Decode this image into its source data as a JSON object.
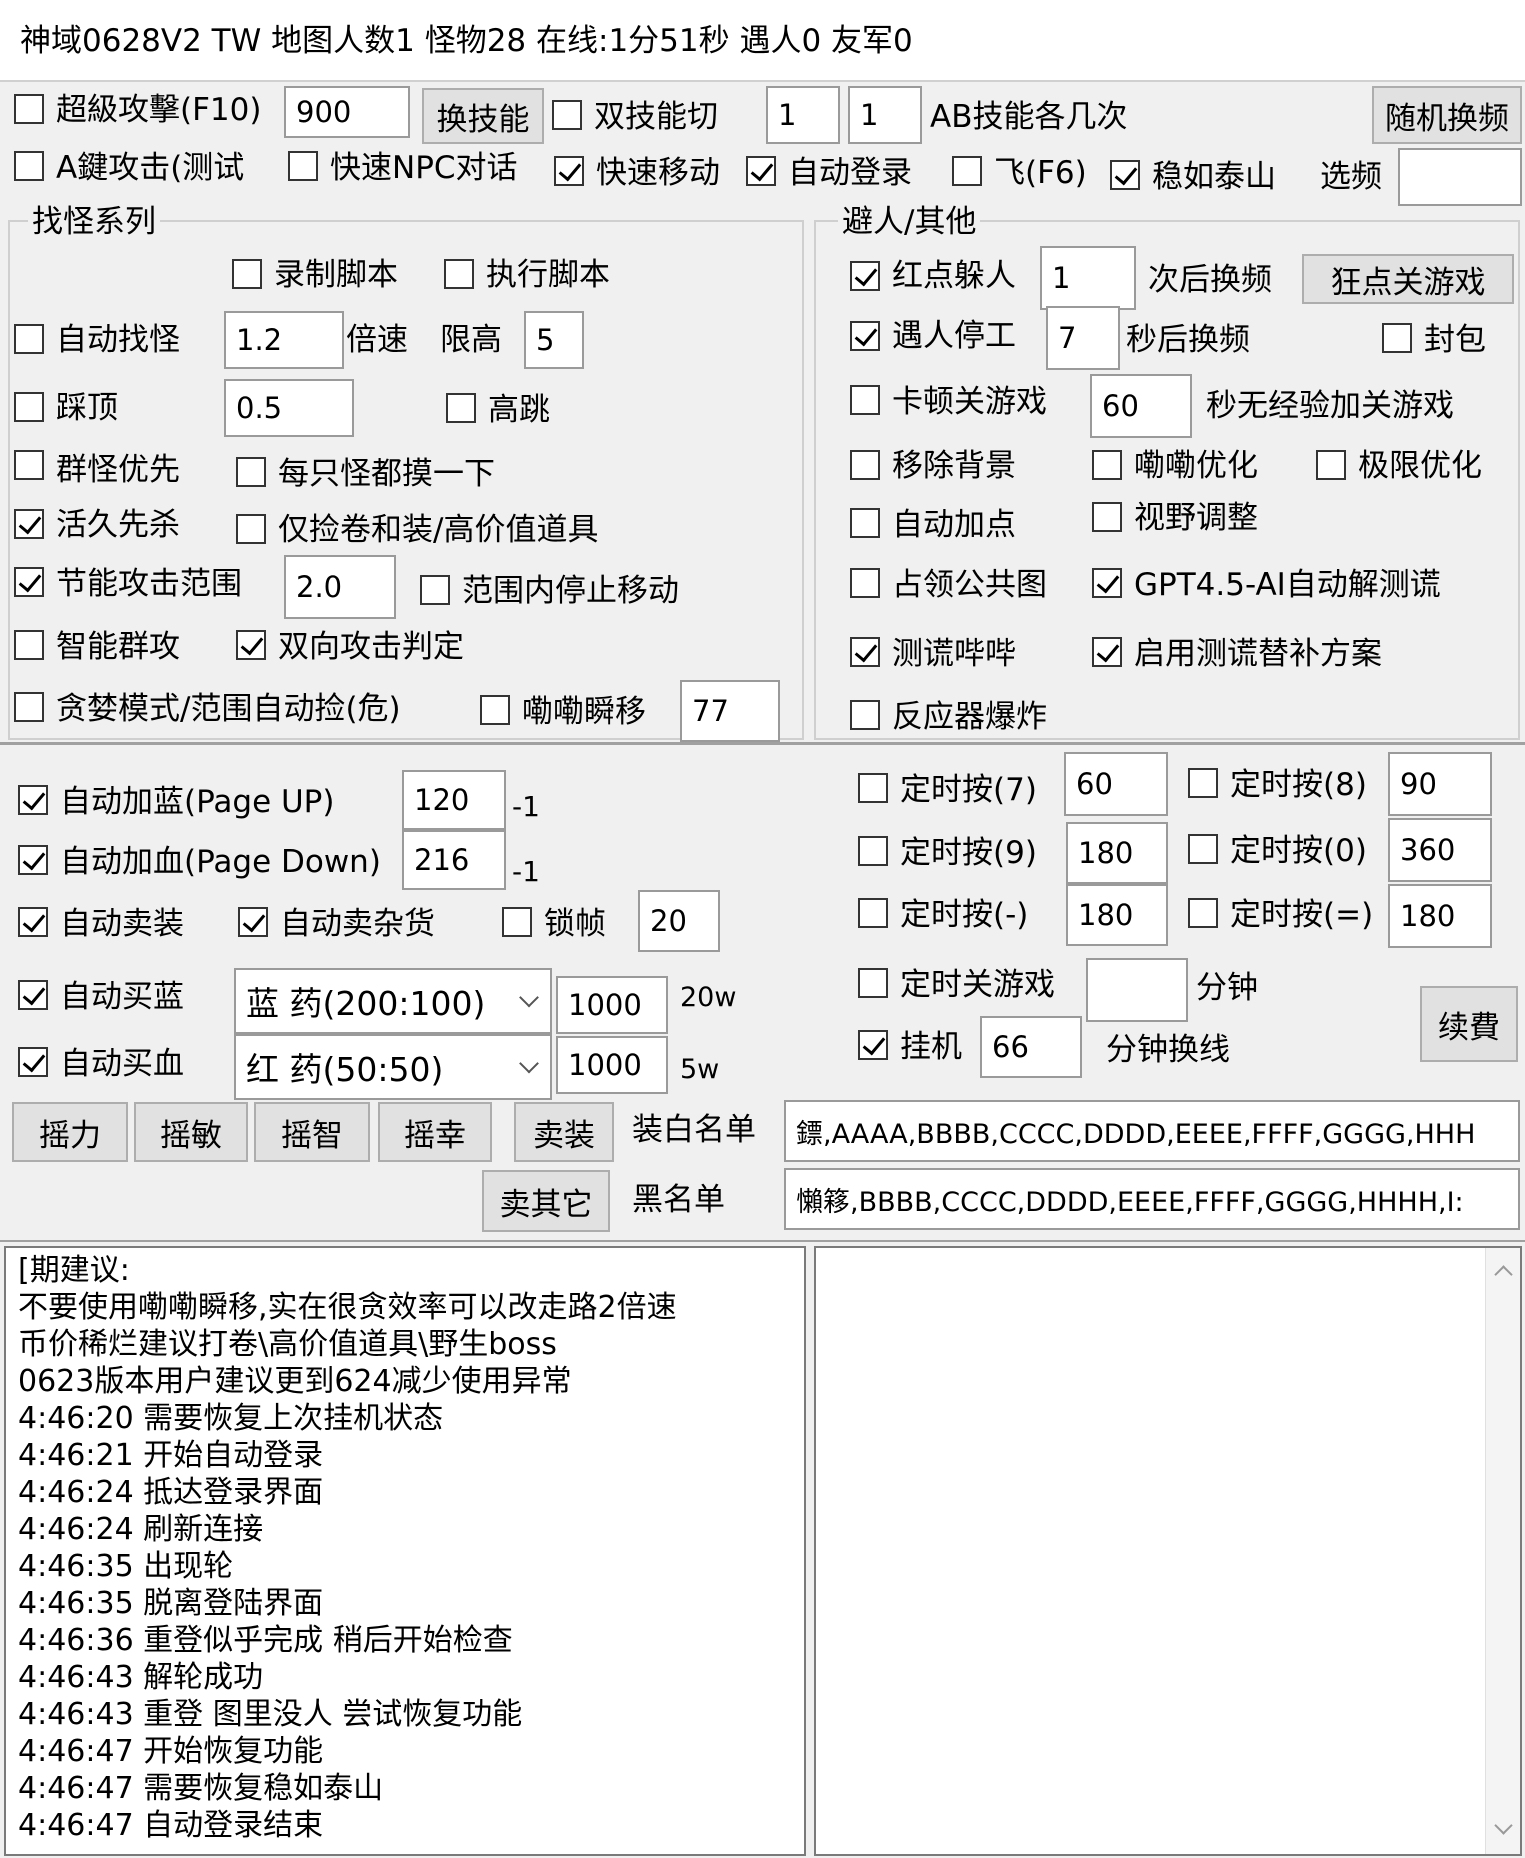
{
  "title": "神域0628V2 TW 地图人数1 怪物28 在线:1分51秒 遇人0 友军0",
  "top": {
    "super_attack": {
      "label": "超級攻擊(F10)",
      "checked": false,
      "value": "900"
    },
    "switch_skill_button": "换技能",
    "dual_skill": {
      "label": "双技能切",
      "checked": false,
      "a": "1",
      "b": "1"
    },
    "ab_label": "AB技能各几次",
    "random_channel_button": "随机换频",
    "a_attack": {
      "label": "A鍵攻击(测试",
      "checked": false
    },
    "fast_npc": {
      "label": "快速NPC对话",
      "checked": false
    },
    "fast_move": {
      "label": "快速移动",
      "checked": true
    },
    "auto_login": {
      "label": "自动登录",
      "checked": true
    },
    "fly": {
      "label": "飞(F6)",
      "checked": false
    },
    "steady": {
      "label": "稳如泰山",
      "checked": true
    },
    "channel_label": "选频",
    "channel_value": ""
  },
  "find_monster": {
    "title": "找怪系列",
    "record_script": {
      "label": "录制脚本",
      "checked": false
    },
    "run_script": {
      "label": "执行脚本",
      "checked": false
    },
    "auto_find": {
      "label": "自动找怪",
      "checked": false,
      "speed": "1.2"
    },
    "speed_label": "倍速",
    "height_limit_label": "限高",
    "height_limit": "5",
    "stomp": {
      "label": "踩顶",
      "checked": false,
      "value": "0.5"
    },
    "high_jump": {
      "label": "高跳",
      "checked": false
    },
    "group_first": {
      "label": "群怪优先",
      "checked": false
    },
    "touch_each": {
      "label": "每只怪都摸一下",
      "checked": false
    },
    "kill_long": {
      "label": "活久先杀",
      "checked": true
    },
    "only_scroll": {
      "label": "仅捡卷和装/高价值道具",
      "checked": false
    },
    "energy_range": {
      "label": "节能攻击范围",
      "checked": true,
      "value": "2.0"
    },
    "stop_in_range": {
      "label": "范围内停止移动",
      "checked": false
    },
    "smart_group": {
      "label": "智能群攻",
      "checked": false
    },
    "two_way": {
      "label": "双向攻击判定",
      "checked": true
    },
    "greedy": {
      "label": "贪婪模式/范围自动捡(危)",
      "checked": false
    },
    "lala_teleport": {
      "label": "嘞嘞瞬移",
      "checked": false,
      "value": "77"
    }
  },
  "avoid": {
    "title": "避人/其他",
    "red_dot": {
      "label": "红点躲人",
      "checked": true,
      "value": "1"
    },
    "after_switch": "次后换频",
    "crazy_close_button": "狂点关游戏",
    "meet_stop": {
      "label": "遇人停工",
      "checked": true,
      "value": "7"
    },
    "sec_switch": "秒后换频",
    "block_packet": {
      "label": "封包",
      "checked": false
    },
    "lag_close": {
      "label": "卡顿关游戏",
      "checked": false,
      "value": "60"
    },
    "no_exp_close": "秒无经验加关游戏",
    "remove_bg": {
      "label": "移除背景",
      "checked": false
    },
    "lala_opt": {
      "label": "嘞嘞优化",
      "checked": false
    },
    "extreme_opt": {
      "label": "极限优化",
      "checked": false
    },
    "auto_points": {
      "label": "自动加点",
      "checked": false
    },
    "view_adjust": {
      "label": "视野调整",
      "checked": false
    },
    "public_map": {
      "label": "占领公共图",
      "checked": false
    },
    "gpt": {
      "label": "GPT4.5-AI自动解测谎",
      "checked": true
    },
    "lie_beep": {
      "label": "测谎哔哔",
      "checked": true
    },
    "lie_backup": {
      "label": "启用测谎替补方案",
      "checked": true
    },
    "reactor": {
      "label": "反应器爆炸",
      "checked": false
    }
  },
  "potions": {
    "auto_mp": {
      "label": "自动加蓝(Page UP)",
      "checked": true,
      "value": "120",
      "suffix": "-1"
    },
    "auto_hp": {
      "label": "自动加血(Page Down)",
      "checked": true,
      "value": "216",
      "suffix": "-1"
    },
    "auto_sell": {
      "label": "自动卖装",
      "checked": true
    },
    "auto_sell_misc": {
      "label": "自动卖杂货",
      "checked": true
    },
    "lock_frame": {
      "label": "锁帧",
      "checked": false,
      "value": "20"
    },
    "buy_mp": {
      "label": "自动买蓝",
      "checked": true,
      "option": "蓝 药(200:100)",
      "qty": "1000",
      "price": "20w"
    },
    "buy_hp": {
      "label": "自动买血",
      "checked": true,
      "option": "红 药(50:50)",
      "qty": "1000",
      "price": "5w"
    }
  },
  "timers": {
    "t7": {
      "label": "定时按(7)",
      "checked": false,
      "value": "60"
    },
    "t8": {
      "label": "定时按(8)",
      "checked": false,
      "value": "90"
    },
    "t9": {
      "label": "定时按(9)",
      "checked": false,
      "value": "180"
    },
    "t0": {
      "label": "定时按(0)",
      "checked": false,
      "value": "360"
    },
    "tminus": {
      "label": "定时按(-)",
      "checked": false,
      "value": "180"
    },
    "tequal": {
      "label": "定时按(=)",
      "checked": false,
      "value": "180"
    },
    "close_timer": {
      "label": "定时关游戏",
      "checked": false,
      "value": ""
    },
    "minutes_label": "分钟",
    "idle": {
      "label": "挂机",
      "checked": true,
      "value": "66"
    },
    "switch_line_label": "分钟换线",
    "renew_button": "续費"
  },
  "bottom_buttons": {
    "str": "摇力",
    "dex": "摇敏",
    "int": "摇智",
    "luk": "摇幸",
    "sell_equip": "卖装",
    "sell_other": "卖其它"
  },
  "whitelist": {
    "label": "装白名单",
    "value": "鏢,AAAA,BBBB,CCCC,DDDD,EEEE,FFFF,GGGG,HHH"
  },
  "blacklist": {
    "label": "黑名单",
    "value": "懶簃,BBBB,CCCC,DDDD,EEEE,FFFF,GGGG,HHHH,I:"
  },
  "log": [
    "[期建议:",
    "不要使用嘞嘞瞬移,实在很贪效率可以改走路2倍速",
    "币价稀烂建议打卷\\高价值道具\\野生boss",
    "0623版本用户建议更到624减少使用异常",
    "4:46:20 需要恢复上次挂机状态",
    "4:46:21 开始自动登录",
    "4:46:24 抵达登录界面",
    "4:46:24 刷新连接",
    "4:46:35 出现轮",
    "4:46:35 脱离登陆界面",
    "4:46:36 重登似乎完成 稍后开始检查",
    "4:46:43 解轮成功",
    "4:46:43 重登 图里没人 尝试恢复功能",
    "4:46:47 开始恢复功能",
    "4:46:47 需要恢复稳如泰山",
    "4:46:47 自动登录结束"
  ]
}
